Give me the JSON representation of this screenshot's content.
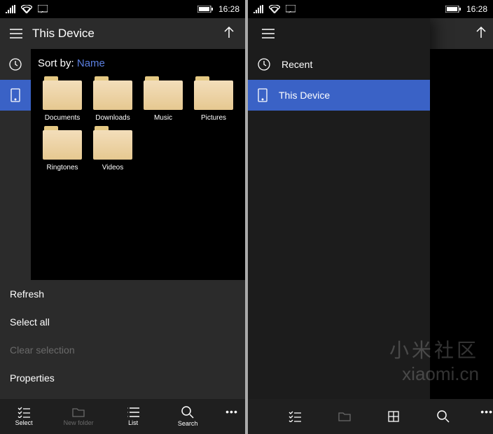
{
  "status": {
    "time": "16:28"
  },
  "left": {
    "title": "This Device",
    "sortLabel": "Sort by:",
    "sortBy": "Name",
    "folders": [
      "Documents",
      "Downloads",
      "Music",
      "Pictures",
      "Ringtones",
      "Videos"
    ],
    "ctx": {
      "refresh": "Refresh",
      "selectAll": "Select all",
      "clearSelection": "Clear selection",
      "properties": "Properties"
    },
    "cmd": {
      "select": "Select",
      "newFolder": "New folder",
      "list": "List",
      "search": "Search"
    }
  },
  "right": {
    "drawer": {
      "recent": "Recent",
      "thisDevice": "This Device"
    }
  },
  "watermark": {
    "zh": "小米社区",
    "en": "xiaomi.cn"
  }
}
